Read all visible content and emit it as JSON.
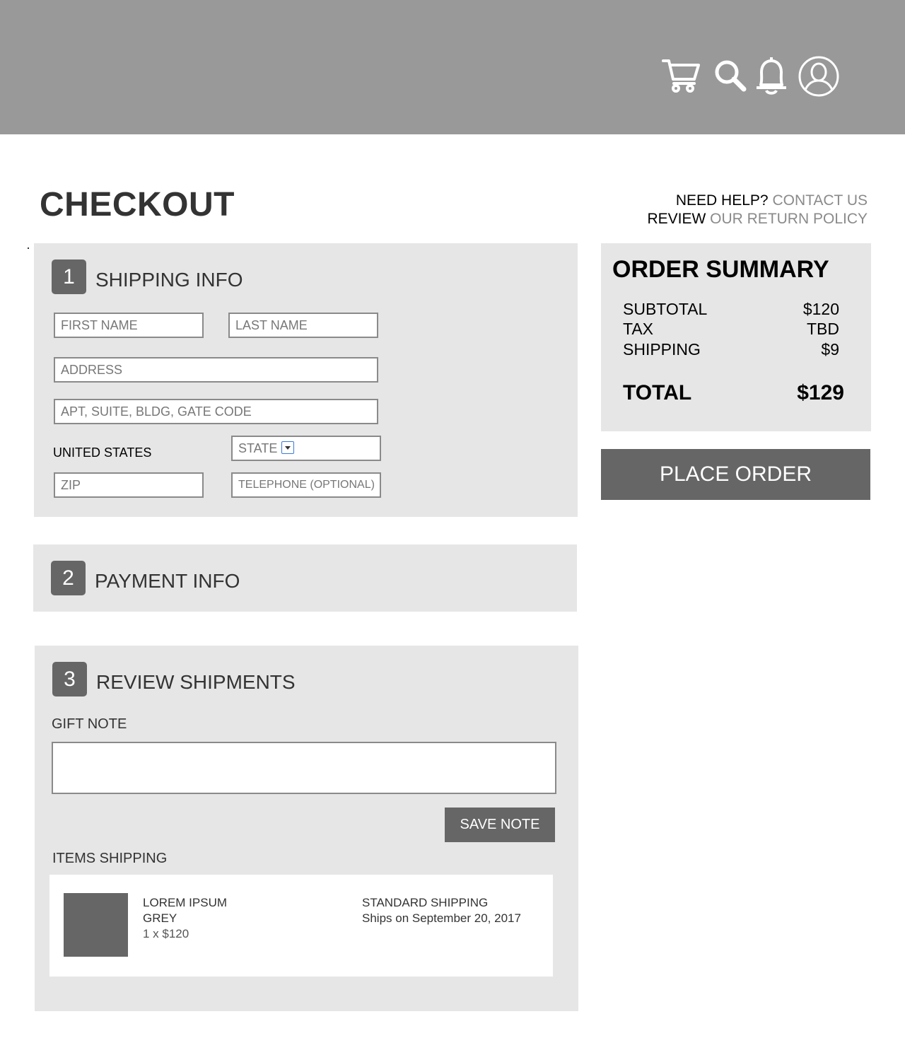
{
  "header": {
    "icons": [
      "cart-icon",
      "search-icon",
      "bell-icon",
      "user-icon"
    ]
  },
  "page": {
    "title": "CHECKOUT"
  },
  "help": {
    "line1_prefix": "NEED HELP?",
    "line1_link": "CONTACT US",
    "line2_prefix": "REVIEW",
    "line2_link": "OUR RETURN POLICY"
  },
  "shipping": {
    "step": "1",
    "title": "SHIPPING INFO",
    "first_name": "FIRST NAME",
    "last_name": "LAST NAME",
    "address": "ADDRESS",
    "apt": "APT, SUITE, BLDG, GATE CODE",
    "country": "UNITED STATES",
    "state": "STATE",
    "zip": "ZIP",
    "telephone": "TELEPHONE (OPTIONAL)"
  },
  "payment": {
    "step": "2",
    "title": "PAYMENT INFO"
  },
  "review": {
    "step": "3",
    "title": "REVIEW SHIPMENTS",
    "gift_note_label": "GIFT NOTE",
    "gift_note_value": "",
    "save_note": "SAVE NOTE",
    "items_label": "ITEMS SHIPPING",
    "item": {
      "name": "LOREM IPSUM",
      "color": "GREY",
      "qty_price": "1 x $120",
      "shipping_method": "STANDARD SHIPPING",
      "ship_date": "Ships on September 20, 2017"
    }
  },
  "summary": {
    "title": "ORDER SUMMARY",
    "subtotal_label": "SUBTOTAL",
    "subtotal_value": "$120",
    "tax_label": "TAX",
    "tax_value": "TBD",
    "shipping_label": "SHIPPING",
    "shipping_value": "$9",
    "total_label": "TOTAL",
    "total_value": "$129",
    "place_order": "PLACE ORDER"
  },
  "colors": {
    "header_bg": "#999999",
    "panel_bg": "#e6e6e6",
    "button_bg": "#666666",
    "link": "#8a8a8a"
  }
}
